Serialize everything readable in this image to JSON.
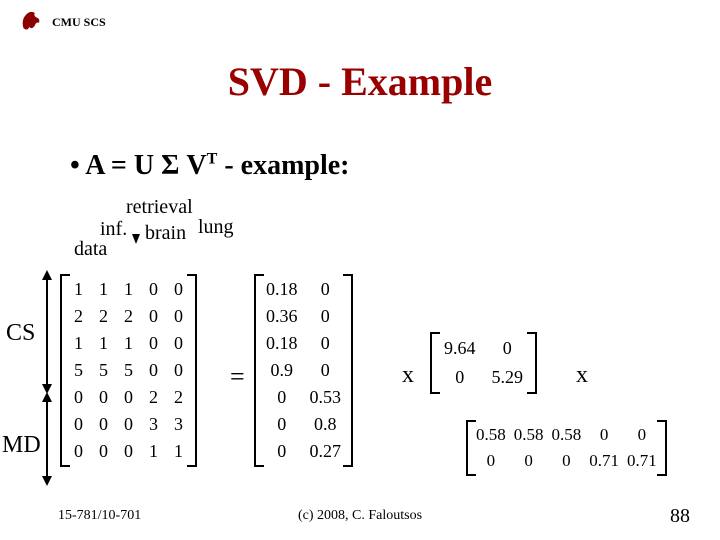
{
  "header": {
    "org": "CMU SCS"
  },
  "title": "SVD - Example",
  "bullet": {
    "prefix": "•  A = U ",
    "sigma": "Σ",
    "vt": " V",
    "sup": "T",
    "suffix": " - example:"
  },
  "col_labels": {
    "retrieval": "retrieval",
    "inf": "inf.",
    "brain": "brain",
    "lung": "lung",
    "data": "data"
  },
  "row_labels": {
    "cs": "CS",
    "md": "MD"
  },
  "ops": {
    "eq": "=",
    "times": "x"
  },
  "footer": {
    "left": "15-781/10-701",
    "center": "(c) 2008, C. Faloutsos",
    "right": "88"
  },
  "chart_data": {
    "type": "table",
    "title": "SVD decomposition A = U Σ Vᵀ",
    "column_labels": [
      "data",
      "inf.",
      "retrieval",
      "brain",
      "lung"
    ],
    "row_groups": [
      {
        "name": "CS",
        "rows": [
          0,
          1,
          2,
          3
        ]
      },
      {
        "name": "MD",
        "rows": [
          4,
          5,
          6
        ]
      }
    ],
    "A": [
      [
        1,
        1,
        1,
        0,
        0
      ],
      [
        2,
        2,
        2,
        0,
        0
      ],
      [
        1,
        1,
        1,
        0,
        0
      ],
      [
        5,
        5,
        5,
        0,
        0
      ],
      [
        0,
        0,
        0,
        2,
        2
      ],
      [
        0,
        0,
        0,
        3,
        3
      ],
      [
        0,
        0,
        0,
        1,
        1
      ]
    ],
    "U": [
      [
        0.18,
        0
      ],
      [
        0.36,
        0
      ],
      [
        0.18,
        0
      ],
      [
        0.9,
        0
      ],
      [
        0,
        0.53
      ],
      [
        0,
        0.8
      ],
      [
        0,
        0.27
      ]
    ],
    "Sigma": [
      [
        9.64,
        0
      ],
      [
        0,
        5.29
      ]
    ],
    "Vt": [
      [
        0.58,
        0.58,
        0.58,
        0,
        0
      ],
      [
        0,
        0,
        0,
        0.71,
        0.71
      ]
    ]
  }
}
